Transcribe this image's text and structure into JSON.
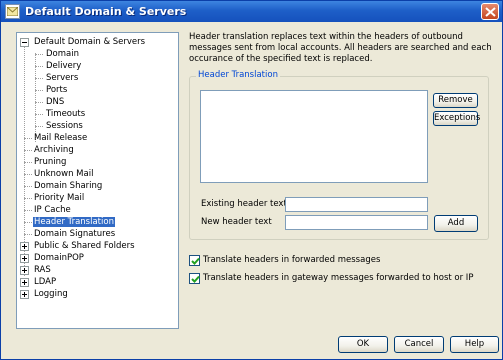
{
  "window": {
    "title": "Default Domain & Servers"
  },
  "tree": {
    "items": [
      {
        "label": "Default Domain & Servers",
        "expander": "minus"
      },
      {
        "label": "Domain"
      },
      {
        "label": "Delivery"
      },
      {
        "label": "Servers"
      },
      {
        "label": "Ports"
      },
      {
        "label": "DNS"
      },
      {
        "label": "Timeouts"
      },
      {
        "label": "Sessions"
      },
      {
        "label": "Mail Release"
      },
      {
        "label": "Archiving"
      },
      {
        "label": "Pruning"
      },
      {
        "label": "Unknown Mail"
      },
      {
        "label": "Domain Sharing"
      },
      {
        "label": "Priority Mail"
      },
      {
        "label": "IP Cache"
      },
      {
        "label": "Header Translation",
        "selected": true
      },
      {
        "label": "Domain Signatures"
      },
      {
        "label": "Public & Shared Folders",
        "expander": "plus"
      },
      {
        "label": "DomainPOP",
        "expander": "plus"
      },
      {
        "label": "RAS",
        "expander": "plus"
      },
      {
        "label": "LDAP",
        "expander": "plus"
      },
      {
        "label": "Logging",
        "expander": "plus"
      }
    ]
  },
  "description": "Header translation replaces text within the headers of outbound messages sent from local accounts.  All headers are searched and each occurance of the specified text is replaced.",
  "header_translation": {
    "group_label": "Header Translation",
    "remove_label": "Remove",
    "exceptions_label": "Exceptions",
    "existing_label": "Existing header text",
    "existing_value": "",
    "new_label": "New header text",
    "new_value": "",
    "add_label": "Add"
  },
  "options": {
    "forwarded_label": "Translate headers in forwarded messages",
    "forwarded_checked": true,
    "gateway_label": "Translate headers in gateway messages forwarded to host or IP",
    "gateway_checked": true
  },
  "footer": {
    "ok_label": "OK",
    "cancel_label": "Cancel",
    "help_label": "Help"
  },
  "colors": {
    "titlebar": "#1e5fc8",
    "selection": "#316ac5",
    "group_label": "#0046d5",
    "dialog_bg": "#ece9d8"
  }
}
